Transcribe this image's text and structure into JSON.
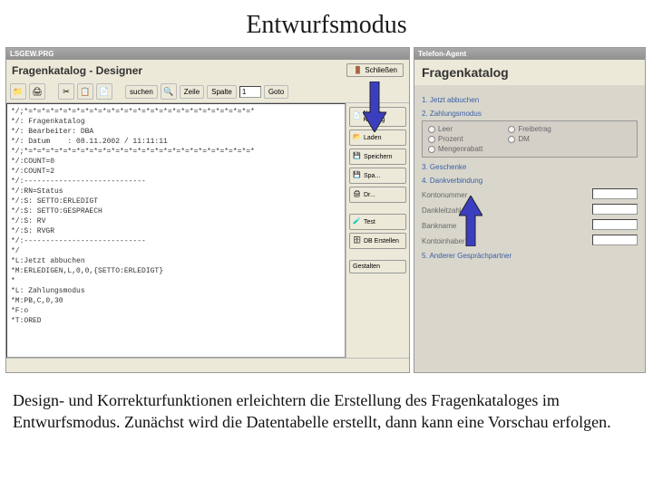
{
  "slide": {
    "title": "Entwurfsmodus",
    "caption": "Design- und Korrekturfunktionen erleichtern die Erstellung des Fragenkataloges im Entwurfsmodus. Zunächst wird die Datentabelle erstellt, dann kann eine Vorschau erfolgen."
  },
  "left": {
    "win_title": "LSGEW.PRG",
    "app_title": "Fragenkatalog - Designer",
    "close_label": "Schließen",
    "toolbar": {
      "btn_suchen": "suchen",
      "label_zeile": "Zeile",
      "label_spalte": "Spalte",
      "input_val": "1",
      "btn_goto": "Goto"
    },
    "code": "*/;*=*=*=*=*=*=*=*=*=*=*=*=*=*=*=*=*=*=*=*=*=*=*=*=*=*=*\n*/: Fragenkatalog\n*/: Bearbeiter: DBA\n*/: Datum    : 08.11.2002 / 11:11:11\n*/;*=*=*=*=*=*=*=*=*=*=*=*=*=*=*=*=*=*=*=*=*=*=*=*=*=*=*\n*/:COUNT=0\n*/:COUNT=2\n*/:----------------------------\n*/:RN=Status\n*/:S: SETTO:ERLEDIGT\n*/:S: SETTO:GESPRAECH\n*/:S: RV\n*/:S: RVGR\n*/:----------------------------\n*/\n*L:Jetzt abbuchen\n*M:ERLEDIGEN,L,0,0,{SETTO:ERLEDIGT}\n*\n*L: Zahlungsmodus\n*M:PB,C,0,30\n*F:o\n*T:ORED",
    "side": {
      "neuer_katalog": "Neuer Katalog",
      "laden": "Laden",
      "speichern": "Speichern",
      "spa": "Spa...",
      "dr": "Dr...",
      "test": "Test",
      "db_erstellen": "DB Erstellen",
      "gestalten": "Gestalten"
    }
  },
  "right": {
    "win_title": "Telefon-Agent",
    "header": "Fragenkatalog",
    "sections": {
      "s1": "1. Jetzt abbuchen",
      "s2": "2. Zahlungsmodus",
      "s3": "3. Geschenke",
      "s4": "4. Dankverbindung",
      "s5": "5. Anderer Gesprächpartner"
    },
    "radios": {
      "leer": "Leer",
      "prozent": "Prozent",
      "mengenrabatt": "Mengenrabatt",
      "freibetrag": "Freibetrag",
      "dm": "DM"
    },
    "fields": {
      "kontonummer": "Kontonummer",
      "dankleitzahl": "Dankleitzahl",
      "bankname": "Bankname",
      "kontoinhaber": "Kontoinhaber"
    }
  }
}
